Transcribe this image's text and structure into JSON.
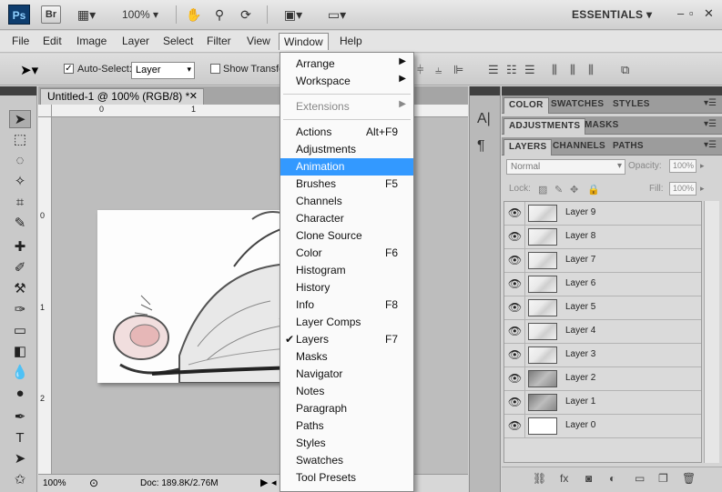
{
  "appbar": {
    "logo": "Ps",
    "bridge": "Br",
    "zoom": "100%",
    "workspace": "ESSENTIALS",
    "icons": [
      "view-extras-icon",
      "hand-icon",
      "zoom-icon",
      "rotate-view-icon",
      "arrange-documents-icon",
      "screen-mode-icon"
    ],
    "window_controls": [
      "minimize",
      "restore",
      "close"
    ]
  },
  "menubar": {
    "items": [
      "File",
      "Edit",
      "Image",
      "Layer",
      "Select",
      "Filter",
      "View",
      "Window",
      "Help"
    ],
    "active": "Window"
  },
  "options": {
    "auto_select_label": "Auto-Select:",
    "auto_select_checked": true,
    "auto_select_value": "Layer",
    "show_transform_label": "Show Transfo"
  },
  "document": {
    "tab_title": "Untitled-1 @ 100% (RGB/8) *",
    "ruler_top": [
      "0",
      "1"
    ],
    "ruler_left": [
      "0",
      "1",
      "2"
    ],
    "zoom": "100%",
    "doc_size": "Doc: 189.8K/2.76M"
  },
  "panels": {
    "group1": [
      "COLOR",
      "SWATCHES",
      "STYLES"
    ],
    "group2": [
      "ADJUSTMENTS",
      "MASKS"
    ],
    "group3": [
      "LAYERS",
      "CHANNELS",
      "PATHS"
    ],
    "blend_mode": "Normal",
    "opacity_label": "Opacity:",
    "opacity_value": "100%",
    "lock_label": "Lock:",
    "fill_label": "Fill:",
    "fill_value": "100%",
    "layers": [
      {
        "name": "Layer 9"
      },
      {
        "name": "Layer 8"
      },
      {
        "name": "Layer 7"
      },
      {
        "name": "Layer 6"
      },
      {
        "name": "Layer 5"
      },
      {
        "name": "Layer 4"
      },
      {
        "name": "Layer 3"
      },
      {
        "name": "Layer 2"
      },
      {
        "name": "Layer 1"
      },
      {
        "name": "Layer 0"
      }
    ]
  },
  "window_menu": {
    "items": [
      {
        "label": "Arrange",
        "submenu": true
      },
      {
        "label": "Workspace",
        "submenu": true
      },
      {
        "separator": true
      },
      {
        "label": "Extensions",
        "submenu": true,
        "disabled": true
      },
      {
        "separator": true
      },
      {
        "label": "Actions",
        "shortcut": "Alt+F9"
      },
      {
        "label": "Adjustments"
      },
      {
        "label": "Animation",
        "highlighted": true
      },
      {
        "label": "Brushes",
        "shortcut": "F5"
      },
      {
        "label": "Channels"
      },
      {
        "label": "Character"
      },
      {
        "label": "Clone Source"
      },
      {
        "label": "Color",
        "shortcut": "F6"
      },
      {
        "label": "Histogram"
      },
      {
        "label": "History"
      },
      {
        "label": "Info",
        "shortcut": "F8"
      },
      {
        "label": "Layer Comps"
      },
      {
        "label": "Layers",
        "shortcut": "F7",
        "checked": true
      },
      {
        "label": "Masks"
      },
      {
        "label": "Navigator"
      },
      {
        "label": "Notes"
      },
      {
        "label": "Paragraph"
      },
      {
        "label": "Paths"
      },
      {
        "label": "Styles"
      },
      {
        "label": "Swatches"
      },
      {
        "label": "Tool Presets"
      }
    ]
  },
  "colors": {
    "menu_highlight": "#3399ff",
    "panel_header": "#404040",
    "ps_logo_bg": "#0e3d6e"
  }
}
